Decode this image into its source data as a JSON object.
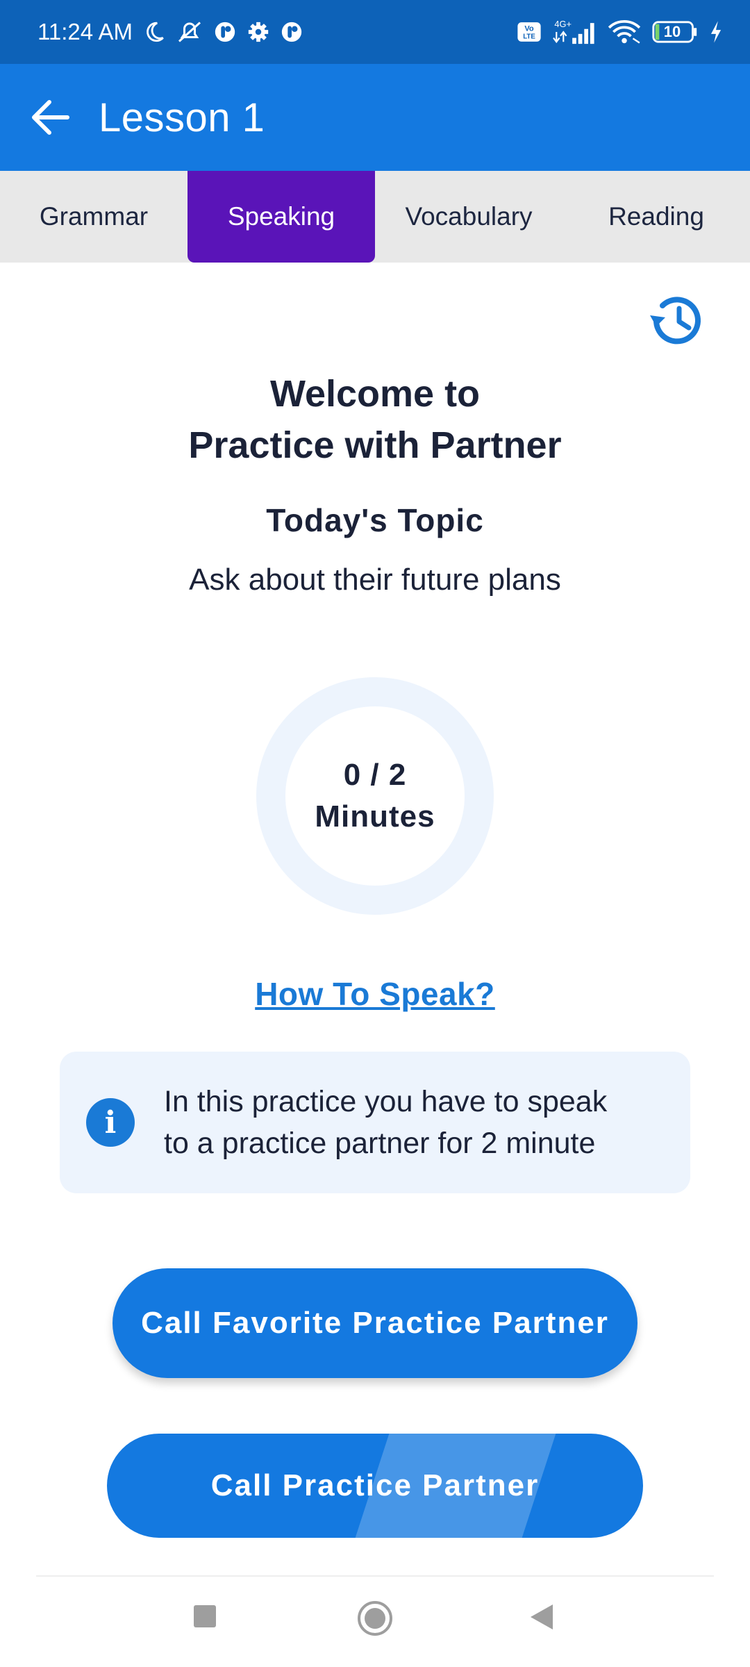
{
  "status_bar": {
    "time": "11:24 AM",
    "left_icons": [
      "moon-icon",
      "bell-off-icon",
      "app-badge-icon",
      "gear-icon",
      "app-badge-icon"
    ],
    "right_icons": [
      "volte-icon",
      "signal-4g-icon",
      "wifi-icon",
      "battery-icon",
      "charging-icon"
    ],
    "network_label": "4G+",
    "volte_label": "Vo LTE",
    "battery_level": "10"
  },
  "app_bar": {
    "title": "Lesson 1",
    "back_icon": "arrow-left-icon",
    "color": "#1479e0"
  },
  "tabs": [
    {
      "label": "Grammar",
      "active": false
    },
    {
      "label": "Speaking",
      "active": true
    },
    {
      "label": "Vocabulary",
      "active": false
    },
    {
      "label": "Reading",
      "active": false
    }
  ],
  "active_tab_color": "#5a14b8",
  "history_icon": "history-icon",
  "welcome": {
    "line1": "Welcome to",
    "line2": "Practice with Partner"
  },
  "topic": {
    "heading": "Today's Topic",
    "text": "Ask about their future plans"
  },
  "progress": {
    "label": "0 / 2",
    "unit": "Minutes",
    "fraction": 0
  },
  "how_to_link": "How To Speak?",
  "info": {
    "icon": "info-icon",
    "text_line1": "In this practice you have to speak",
    "text_line2": "to a practice partner for 2 minute"
  },
  "buttons": {
    "favorite": "Call Favorite Practice Partner",
    "call": "Call Practice Partner"
  },
  "nav": {
    "recents_icon": "square-icon",
    "home_icon": "circle-home-icon",
    "back_icon": "triangle-back-icon"
  }
}
